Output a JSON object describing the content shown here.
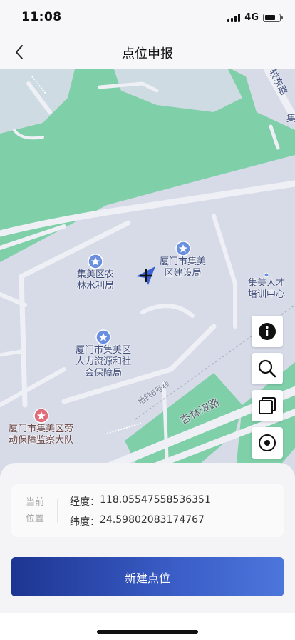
{
  "status_bar": {
    "time": "11:08",
    "network": "4G"
  },
  "nav": {
    "title": "点位申报",
    "back_icon": "chevron-left-icon"
  },
  "map": {
    "pois": [
      {
        "name": "集美区农\n林水利局",
        "type": "government",
        "color": "#6b8fe0"
      },
      {
        "name": "厦门市集美\n区建设局",
        "type": "government",
        "color": "#6b8fe0"
      },
      {
        "name": "厦门市集美区\n人力资源和社\n会保障局",
        "type": "government",
        "color": "#6b8fe0"
      },
      {
        "name": "厦门市集美区劳\n动保障监察大队",
        "type": "government",
        "color": "#e06b7a"
      },
      {
        "name": "集美人才\n培训中心",
        "type": "education",
        "color": "#6b8fe0"
      }
    ],
    "roads": [
      "杏林湾路",
      "地铁6号线"
    ],
    "edge_labels": [
      "较东路",
      "集"
    ],
    "colors": {
      "land": "#d7dbe8",
      "green": "#7fcfa9",
      "road": "#eef0f6"
    },
    "tools": [
      {
        "name": "info",
        "icon": "info-icon"
      },
      {
        "name": "search",
        "icon": "search-icon"
      },
      {
        "name": "layers",
        "icon": "layers-icon"
      },
      {
        "name": "locate",
        "icon": "locate-icon"
      }
    ]
  },
  "location": {
    "label": "当前\n位置",
    "longitude_label": "经度：",
    "longitude": "118.05547558536351",
    "latitude_label": "纬度：",
    "latitude": "24.59802083174767"
  },
  "actions": {
    "create_label": "新建点位"
  }
}
